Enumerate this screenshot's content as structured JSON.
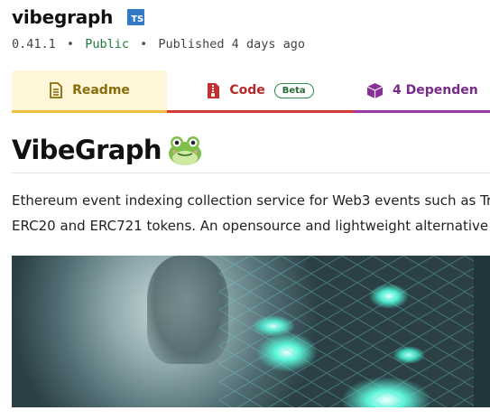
{
  "package": {
    "name": "vibegraph",
    "ts_badge": "TS",
    "version": "0.41.1",
    "separator": "•",
    "visibility": "Public",
    "published": "Published 4 days ago"
  },
  "tabs": [
    {
      "label": "Readme",
      "icon": "document-icon",
      "active": true,
      "color": "#8a6d0a"
    },
    {
      "label": "Code",
      "icon": "file-code-icon",
      "badge": "Beta",
      "color": "#b92828"
    },
    {
      "label": "4 Dependen",
      "icon": "cube-icon",
      "color": "#7a2a8a"
    }
  ],
  "readme": {
    "title": "VibeGraph",
    "title_emoji": "frog-icon",
    "description_lines": [
      "Ethereum event indexing collection service for Web3 events such as Tr",
      "ERC20 and ERC721 tokens. An opensource and lightweight alternative"
    ],
    "hero_image": "futuristic-network-illustration"
  },
  "colors": {
    "ts_badge": "#3178c6",
    "public": "#1e7a3c",
    "readme_tab_bg": "#fff5d9",
    "readme_underline": "#f0c040",
    "code_underline": "#d43c3c",
    "deps_underline": "#9b3aa8"
  }
}
